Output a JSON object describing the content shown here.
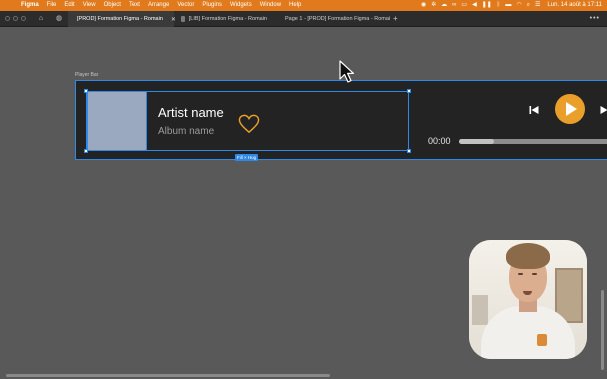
{
  "menubar": {
    "app": "Figma",
    "items": [
      "File",
      "Edit",
      "View",
      "Object",
      "Text",
      "Arrange",
      "Vector",
      "Plugins",
      "Widgets",
      "Window",
      "Help"
    ],
    "clock": "Lun. 14 août à 17:11",
    "status_icons": [
      "record-icon",
      "settings-icon",
      "creative-cloud-icon",
      "link-icon",
      "display-icon",
      "volume-icon",
      "pause-icon",
      "bluetooth-icon",
      "battery-icon",
      "wifi-icon",
      "search-icon",
      "control-center-icon"
    ]
  },
  "tabs": [
    {
      "label": "[PROD] Formation Figma - Romain",
      "active": true
    },
    {
      "label": "[LIB] Formation Figma - Romain",
      "active": false
    },
    {
      "label": "Page 1 - [PROD] Formation Figma - Romai",
      "active": false
    }
  ],
  "canvas": {
    "frame_name": "Player Bar",
    "artist_name": "Artist name",
    "album_name": "Album name",
    "selection_label": "Fill × Hug",
    "time": "00:00",
    "progress_fraction": 0.22
  },
  "colors": {
    "accent": "#e99f2a",
    "selection": "#2f89e6",
    "menubar": "#e07a1c",
    "canvas": "#595959",
    "player_bg": "#232323"
  }
}
